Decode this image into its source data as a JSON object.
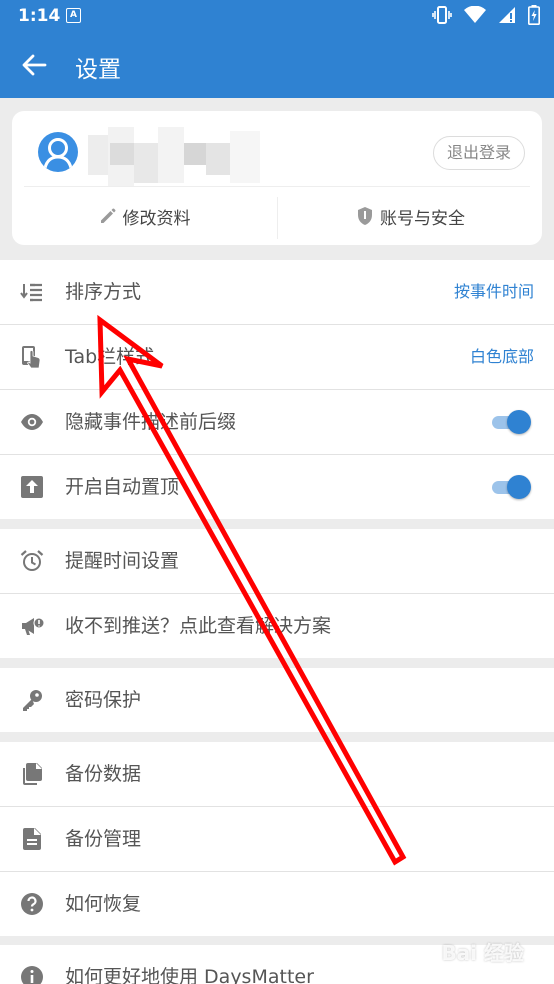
{
  "status_bar": {
    "time": "1:14",
    "notif_letter": "A"
  },
  "app_bar": {
    "title": "设置"
  },
  "account_card": {
    "logout_label": "退出登录",
    "edit_profile_label": "修改资料",
    "account_security_label": "账号与安全"
  },
  "settings": {
    "sort": {
      "label": "排序方式",
      "value": "按事件时间"
    },
    "tab_style": {
      "label": "Tab栏样式",
      "value": "白色底部"
    },
    "hide_affix": {
      "label": "隐藏事件描述前后缀",
      "enabled": true
    },
    "auto_top": {
      "label": "开启自动置顶",
      "enabled": true
    },
    "reminder": {
      "label": "提醒时间设置"
    },
    "push_help": {
      "label": "收不到推送？点此查看解决方案"
    },
    "password": {
      "label": "密码保护"
    },
    "backup_data": {
      "label": "备份数据"
    },
    "backup_manage": {
      "label": "备份管理"
    },
    "restore_help": {
      "label": "如何恢复"
    },
    "usage_help": {
      "label": "如何更好地使用 DaysMatter"
    }
  },
  "watermark": {
    "text": "Bai 经验"
  },
  "colors": {
    "primary": "#2f82d2",
    "accent_track": "#9cc3ea",
    "annotation": "#ff0000"
  }
}
